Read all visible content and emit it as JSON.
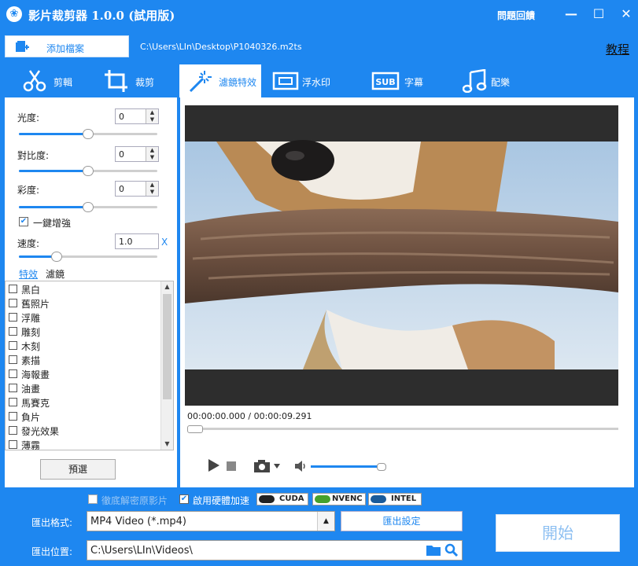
{
  "app": {
    "title": "影片裁剪器 1.0.0 (試用版)",
    "feedback": "問題回饋",
    "minimize": "—",
    "maximize": "☐",
    "close": "✕"
  },
  "toolbar": {
    "add_file": "添加檔案",
    "file_path": "C:\\Users\\LIn\\Desktop\\P1040326.m2ts",
    "tutorial": "教程"
  },
  "tabs": [
    {
      "label": "剪輯",
      "icon": "scissors-icon"
    },
    {
      "label": "裁剪",
      "icon": "crop-icon"
    },
    {
      "label": "濾鏡特效",
      "icon": "magic-wand-icon",
      "active": true
    },
    {
      "label": "浮水印",
      "icon": "watermark-icon"
    },
    {
      "label": "字幕",
      "icon": "subtitle-icon",
      "icon_text": "SUB"
    },
    {
      "label": "配樂",
      "icon": "music-icon"
    }
  ],
  "adjust": {
    "brightness_label": "光度:",
    "brightness_value": "0",
    "brightness_level": 0.5,
    "contrast_label": "對比度:",
    "contrast_value": "0",
    "contrast_level": 0.5,
    "saturation_label": "彩度:",
    "saturation_value": "0",
    "saturation_level": 0.5,
    "enhance_label": "一鍵增強",
    "enhance_checked": true,
    "speed_label": "速度:",
    "speed_value": "1.0",
    "speed_unit": "X",
    "speed_level": 0.25
  },
  "effects": {
    "tab_effects": "特效",
    "tab_filters": "濾鏡",
    "items": [
      "黑白",
      "舊照片",
      "浮雕",
      "雕刻",
      "木刻",
      "素描",
      "海報畫",
      "油畫",
      "馬賽克",
      "負片",
      "發光效果",
      "薄霧"
    ],
    "preset_button": "預選"
  },
  "player": {
    "time": "00:00:00.000 / 00:00:09.291",
    "progress": 0.0,
    "volume": 1.0
  },
  "export": {
    "hw_decode_label": "徹底解密原影片",
    "hw_accel_label": "啟用硬體加速",
    "hw_accel_checked": true,
    "badges": [
      "CUDA",
      "NVENC",
      "INTEL"
    ],
    "format_label": "匯出格式:",
    "format_value": "MP4 Video (*.mp4)",
    "settings_button": "匯出設定",
    "location_label": "匯出位置:",
    "location_value": "C:\\Users\\LIn\\Videos\\",
    "start_button": "開始"
  },
  "colors": {
    "accent": "#1e87f0",
    "panel": "#ffffff",
    "video_bg": "#2d2d2d"
  }
}
